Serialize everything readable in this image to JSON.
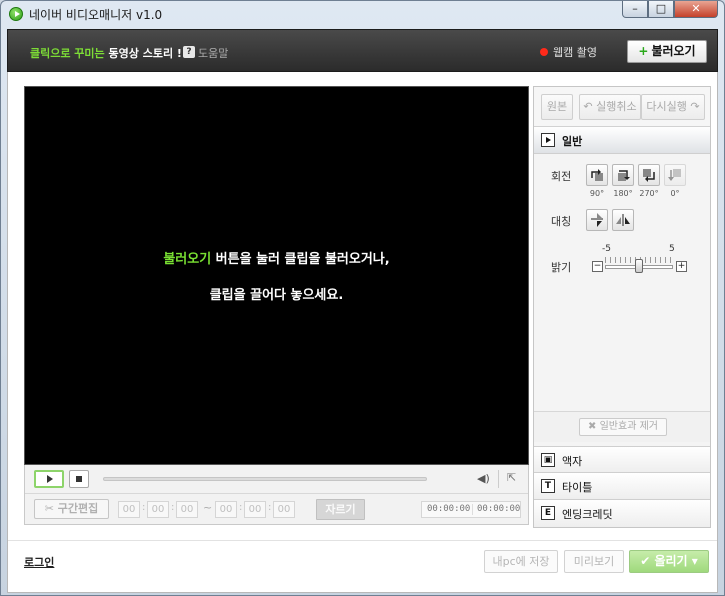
{
  "window": {
    "title": "네이버 비디오매니저 v1.0",
    "minimize": "–",
    "maximize": "□",
    "close": "✕"
  },
  "header": {
    "slogan_part1": "클릭으로 꾸미는",
    "slogan_part2": "동영상 스토리 !",
    "help_icon": "?",
    "help_label": "도움말",
    "webcam_label": "웹캠 촬영",
    "load_button_plus": "+",
    "load_button_label": "불러오기"
  },
  "video": {
    "msg_highlight": "불러오기",
    "msg_line1_rest": " 버튼을 눌러 클립을 불러오거나,",
    "msg_line2": "클립을 끌어다 놓으세요."
  },
  "controls": {
    "volume_icon": "◀)",
    "expand_icon": "⇱",
    "cut_edit_label": "✂ 구간편집",
    "time_fields": [
      "00",
      "00",
      "00",
      "00",
      "00",
      "00"
    ],
    "tilde": "~",
    "cut_button": "자르기",
    "time_current": "00:00:00",
    "time_total": "00:00:00",
    "colon": ":"
  },
  "panel": {
    "original": "원본",
    "undo": "↶ 실행취소",
    "redo": "다시실행 ↷",
    "section_general": "일반",
    "rotate_label": "회전",
    "rotate_degrees": [
      "90°",
      "180°",
      "270°",
      "0°"
    ],
    "flip_label": "대칭",
    "brightness_label": "밝기",
    "brightness_min": "-5",
    "brightness_max": "5",
    "minus": "−",
    "plus": "+",
    "reset_button": "✖ 일반효과 제거",
    "section_frame": "액자",
    "section_frame_icon": "▣",
    "section_title": "타이틀",
    "section_title_icon": "T",
    "section_credits": "엔딩크레딧",
    "section_credits_icon": "E"
  },
  "footer": {
    "login": "로그인",
    "save_pc": "내pc에 저장",
    "preview": "미리보기",
    "upload": "✔ 올리기 ▾"
  }
}
